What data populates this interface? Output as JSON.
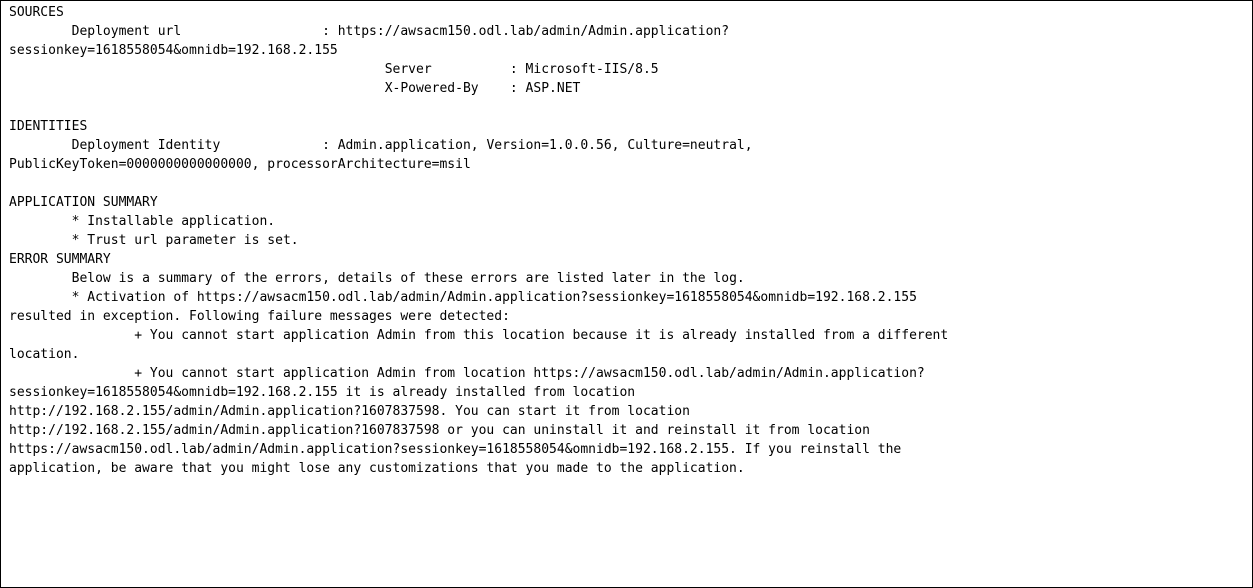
{
  "log": {
    "lines": [
      "SOURCES",
      "\tDeployment url\t\t\t: https://awsacm150.odl.lab/admin/Admin.application?",
      "sessionkey=1618558054&omnidb=192.168.2.155",
      "\t\t\t\t\t\tServer\t\t: Microsoft-IIS/8.5",
      "\t\t\t\t\t\tX-Powered-By\t: ASP.NET",
      "",
      "IDENTITIES",
      "\tDeployment Identity\t\t: Admin.application, Version=1.0.0.56, Culture=neutral,",
      "PublicKeyToken=0000000000000000, processorArchitecture=msil",
      "",
      "APPLICATION SUMMARY",
      "\t* Installable application.",
      "\t* Trust url parameter is set.",
      "ERROR SUMMARY",
      "\tBelow is a summary of the errors, details of these errors are listed later in the log.",
      "\t* Activation of https://awsacm150.odl.lab/admin/Admin.application?sessionkey=1618558054&omnidb=192.168.2.155",
      "resulted in exception. Following failure messages were detected:",
      "\t\t+ You cannot start application Admin from this location because it is already installed from a different",
      "location.",
      "\t\t+ You cannot start application Admin from location https://awsacm150.odl.lab/admin/Admin.application?",
      "sessionkey=1618558054&omnidb=192.168.2.155 it is already installed from location",
      "http://192.168.2.155/admin/Admin.application?1607837598. You can start it from location",
      "http://192.168.2.155/admin/Admin.application?1607837598 or you can uninstall it and reinstall it from location",
      "https://awsacm150.odl.lab/admin/Admin.application?sessionkey=1618558054&omnidb=192.168.2.155. If you reinstall the",
      "application, be aware that you might lose any customizations that you made to the application."
    ]
  }
}
